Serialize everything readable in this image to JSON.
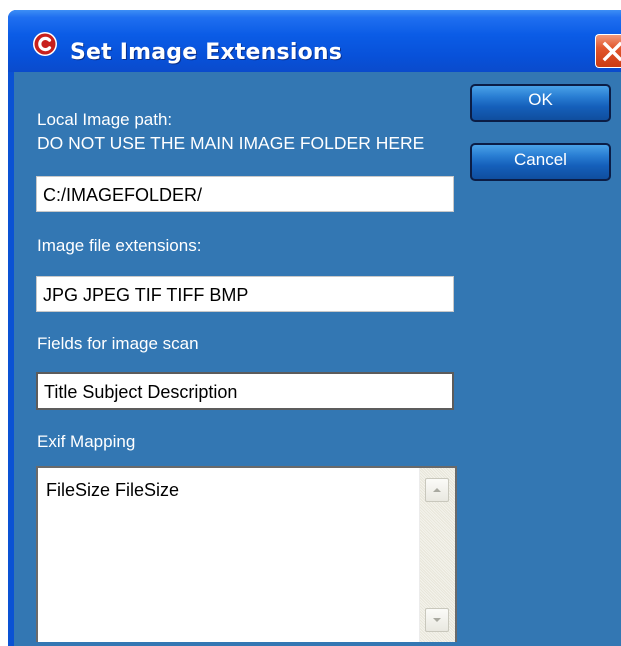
{
  "window": {
    "title": "Set Image Extensions"
  },
  "fields": {
    "local_image_path_label": "Local Image path:",
    "local_image_path_warning": "DO NOT USE THE MAIN IMAGE FOLDER HERE",
    "local_image_path_value": "C:/IMAGEFOLDER/",
    "image_extensions_label": "Image file extensions:",
    "image_extensions_value": "JPG JPEG TIF TIFF BMP",
    "image_scan_fields_label": "Fields for image scan",
    "image_scan_fields_value": "Title Subject Description",
    "exif_mapping_label": "Exif Mapping",
    "exif_mapping_value": "FileSize FileSize"
  },
  "buttons": {
    "ok_label": "OK",
    "cancel_label": "Cancel"
  },
  "icons": {
    "app_icon": "red-circle-app-icon",
    "close_icon": "close-x-icon",
    "scroll_up_icon": "scroll-up-arrow-icon",
    "scroll_down_icon": "scroll-down-arrow-icon"
  },
  "colors": {
    "titlebar_blue": "#0a52d4",
    "dialog_background": "#3377b3",
    "close_button_red": "#e2572d",
    "button_blue": "#1560bb"
  }
}
